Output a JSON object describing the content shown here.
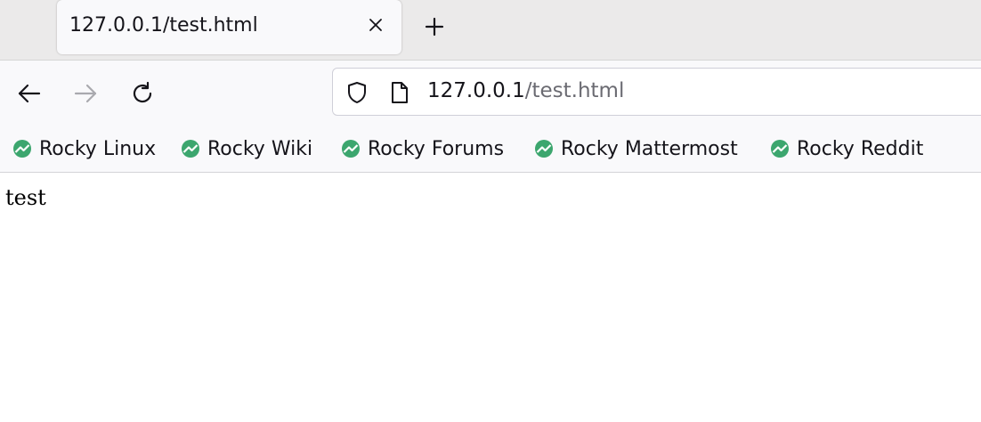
{
  "tab": {
    "title": "127.0.0.1/test.html"
  },
  "icons": {
    "close": "close-icon",
    "new_tab": "plus-icon",
    "back": "arrow-left-icon",
    "forward": "arrow-right-icon",
    "reload": "reload-icon",
    "shield": "shield-icon",
    "page": "page-icon",
    "bookmark": "rocky-linux-logo-icon"
  },
  "urlbar": {
    "host": "127.0.0.1",
    "path": "/test.html"
  },
  "bookmarks": [
    {
      "label": "Rocky Linux"
    },
    {
      "label": "Rocky Wiki"
    },
    {
      "label": "Rocky Forums"
    },
    {
      "label": "Rocky Mattermost"
    },
    {
      "label": "Rocky Reddit"
    }
  ],
  "page": {
    "body_text": "test"
  },
  "colors": {
    "rocky_green": "#3ca66e",
    "tabstrip_bg": "#ebeaea",
    "toolbar_bg": "#f9f9fb"
  }
}
